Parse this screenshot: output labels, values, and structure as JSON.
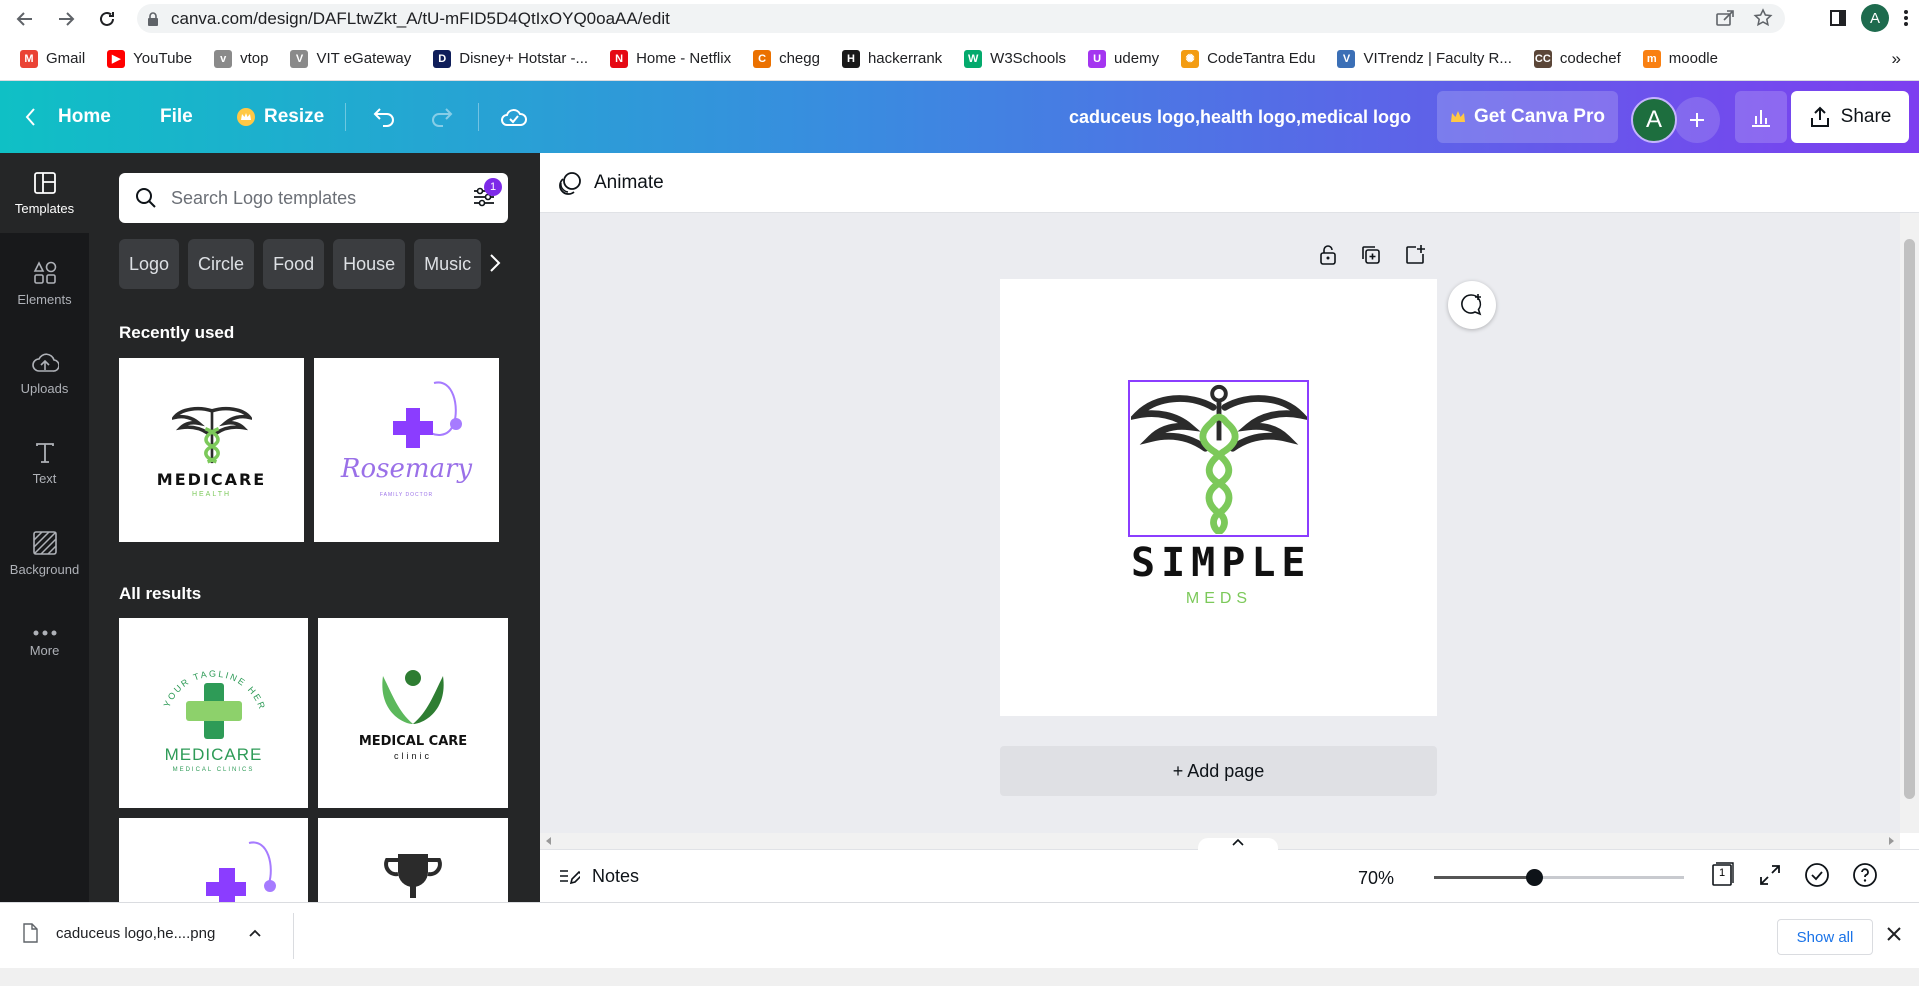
{
  "browser": {
    "url": "canva.com/design/DAFLtwZkt_A/tU-mFID5D4QtIxOYQ0oaAA/edit",
    "profile_initial": "A"
  },
  "bookmarks": [
    {
      "label": "Gmail",
      "color": "#ea4335",
      "glyph": "M"
    },
    {
      "label": "YouTube",
      "color": "#ff0000",
      "glyph": "▶"
    },
    {
      "label": "vtop",
      "color": "#8a8a8a",
      "glyph": "v"
    },
    {
      "label": "VIT eGateway",
      "color": "#8a8a8a",
      "glyph": "V"
    },
    {
      "label": "Disney+ Hotstar -...",
      "color": "#0f1e5a",
      "glyph": "D"
    },
    {
      "label": "Home - Netflix",
      "color": "#e50914",
      "glyph": "N"
    },
    {
      "label": "chegg",
      "color": "#eb7100",
      "glyph": "C"
    },
    {
      "label": "hackerrank",
      "color": "#1a1a1a",
      "glyph": "H"
    },
    {
      "label": "W3Schools",
      "color": "#04aa6d",
      "glyph": "W"
    },
    {
      "label": "udemy",
      "color": "#a435f0",
      "glyph": "U"
    },
    {
      "label": "CodeTantra Edu",
      "color": "#f39c12",
      "glyph": "✺"
    },
    {
      "label": "VITrendz | Faculty R...",
      "color": "#3b6fb6",
      "glyph": "V"
    },
    {
      "label": "codechef",
      "color": "#5b4638",
      "glyph": "CC"
    },
    {
      "label": "moodle",
      "color": "#f98012",
      "glyph": "m"
    }
  ],
  "header": {
    "home": "Home",
    "file": "File",
    "resize": "Resize",
    "title": "caduceus logo,health logo,medical logo",
    "get_pro": "Get Canva Pro",
    "avatar_initial": "A",
    "share": "Share"
  },
  "rail": [
    {
      "label": "Templates",
      "icon": "templates-icon"
    },
    {
      "label": "Elements",
      "icon": "elements-icon"
    },
    {
      "label": "Uploads",
      "icon": "uploads-icon"
    },
    {
      "label": "Text",
      "icon": "text-icon"
    },
    {
      "label": "Background",
      "icon": "background-icon"
    },
    {
      "label": "More",
      "icon": "more-icon"
    }
  ],
  "panel": {
    "search_placeholder": "Search Logo templates",
    "filter_badge": "1",
    "chips": [
      "Logo",
      "Circle",
      "Food",
      "House",
      "Music"
    ],
    "recently_used": "Recently used",
    "all_results": "All results",
    "recent": [
      {
        "title": "MEDICARE",
        "sub": "HEALTH"
      },
      {
        "title": "Rosemary",
        "sub": "FAMILY DOCTOR"
      }
    ],
    "results": [
      {
        "title": "MEDICARE",
        "sub": "MEDICAL CLINICS",
        "arc": "YOUR TAGLINE HERE"
      },
      {
        "title": "MEDICAL CARE",
        "sub": "clinic"
      }
    ]
  },
  "editor": {
    "animate": "Animate",
    "logo_title": "SIMPLE",
    "logo_sub": "MEDS",
    "add_page": "+ Add page",
    "notes": "Notes",
    "zoom": "70%",
    "zoom_fraction": 0.4,
    "page_count": "1"
  },
  "downloads": {
    "file": "caduceus logo,he....png",
    "show_all": "Show all"
  },
  "colors": {
    "accent": "#8b3dff",
    "logo_green": "#7cc95a",
    "logo_dark": "#2b2b2b"
  }
}
